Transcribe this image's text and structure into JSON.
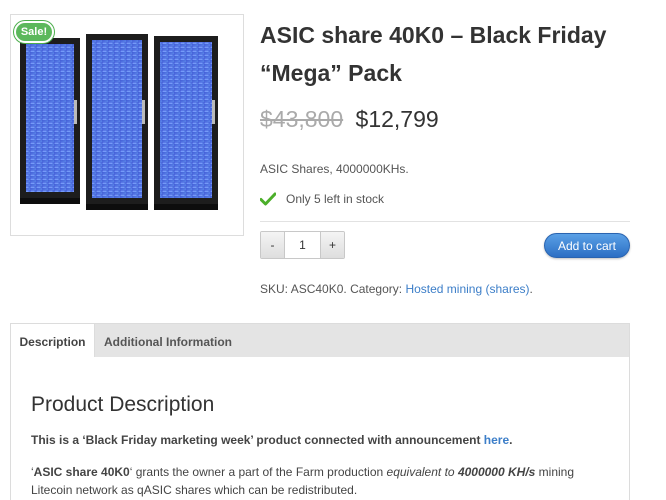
{
  "product": {
    "sale_badge": "Sale!",
    "title": "ASIC share 40K0 – Black Friday “Mega” Pack",
    "old_price": "$43,800",
    "price": "$12,799",
    "short_description": "ASIC Shares, 4000000KHs.",
    "stock": "Only 5 left in stock",
    "quantity": "1",
    "minus_label": "-",
    "plus_label": "+",
    "add_to_cart": "Add to cart",
    "meta": {
      "sku_label": "SKU:",
      "sku": "ASC40K0.",
      "category_label": "Category:",
      "category": "Hosted mining (shares)",
      "end": "."
    },
    "colors": {
      "badge": "#5cb85c",
      "button": "#2c6fc4",
      "link": "#3c7ec8",
      "check": "#4caf2a"
    }
  },
  "tabs": [
    {
      "label": "Description",
      "active": true
    },
    {
      "label": "Additional Information",
      "active": false
    }
  ],
  "description": {
    "heading": "Product Description",
    "p1_text": "This is a ‘Black Friday marketing week’ product connected with announcement",
    "p1_link": "here",
    "p1_end": ".",
    "p2_part1": "‘",
    "p2_bold1": "ASIC share 40K0",
    "p2_part2": "‘ grants the owner a part of the Farm production ",
    "p2_italic": "equivalent to",
    "p2_bolditalic": "4000000 KH/s",
    "p2_part3": " mining Litecoin network as qASIC shares which can be redistributed."
  },
  "icons": {
    "stock_icon": "check-icon"
  }
}
